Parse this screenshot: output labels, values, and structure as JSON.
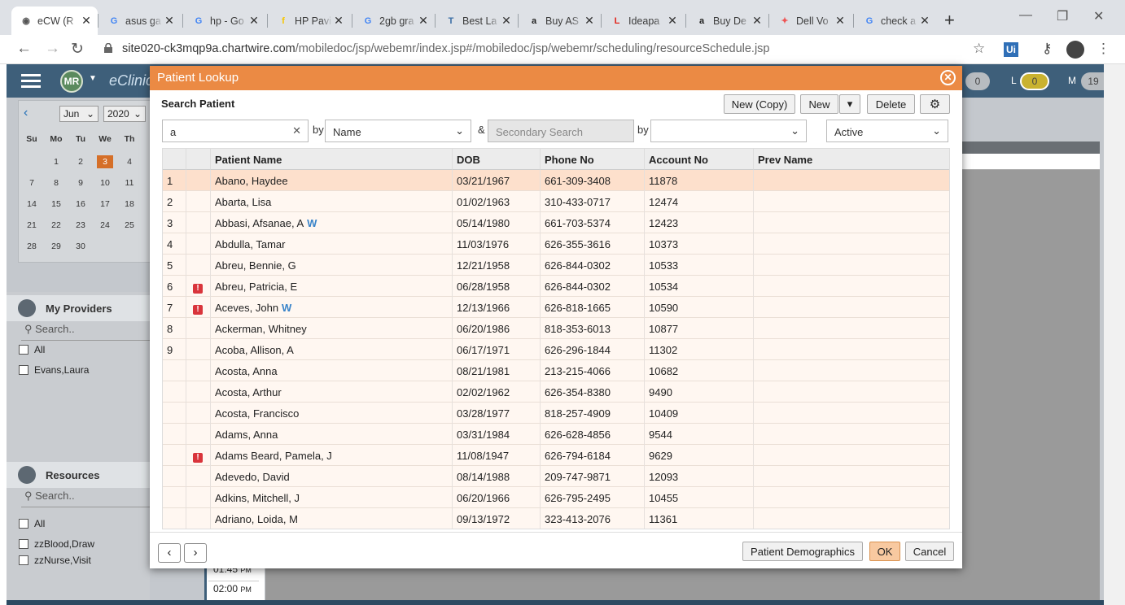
{
  "browser": {
    "tabs": [
      {
        "title": "eCW (R",
        "icon": "ecw-icon",
        "fav": "◉",
        "color": "#555"
      },
      {
        "title": "asus ga",
        "icon": "google-icon",
        "fav": "G",
        "color": "#4285f4"
      },
      {
        "title": "hp - Go",
        "icon": "google-icon",
        "fav": "G",
        "color": "#4285f4"
      },
      {
        "title": "HP Pavi",
        "icon": "flipkart-icon",
        "fav": "f",
        "color": "#f7c600"
      },
      {
        "title": "2gb gra",
        "icon": "google-icon",
        "fav": "G",
        "color": "#4285f4"
      },
      {
        "title": "Best La",
        "icon": "tab-icon",
        "fav": "T",
        "color": "#3b6ea5"
      },
      {
        "title": "Buy AS",
        "icon": "amazon-icon",
        "fav": "a",
        "color": "#222"
      },
      {
        "title": "Ideapa",
        "icon": "lenovo-icon",
        "fav": "L",
        "color": "#e2231a"
      },
      {
        "title": "Buy De",
        "icon": "amazon-icon",
        "fav": "a",
        "color": "#222"
      },
      {
        "title": "Dell Vo",
        "icon": "dell-icon",
        "fav": "✦",
        "color": "#e55"
      },
      {
        "title": "check a",
        "icon": "google-icon",
        "fav": "G",
        "color": "#4285f4"
      }
    ],
    "url_host": "site020-ck3mqp9a.chartwire.com",
    "url_path": "/mobiledoc/jsp/webemr/index.jsp#/mobiledoc/jsp/webemr/scheduling/resourceSchedule.jsp"
  },
  "app": {
    "user_initials": "MR",
    "brand": "eClinic",
    "pill_a": "0",
    "pill_l_label": "L",
    "pill_l": "0",
    "pill_m_label": "M",
    "pill_m": "19"
  },
  "calendar": {
    "month": "Jun",
    "year": "2020",
    "weekdays": [
      "Su",
      "Mo",
      "Tu",
      "We",
      "Th"
    ],
    "weeks": [
      [
        "",
        "1",
        "2",
        "3",
        "4"
      ],
      [
        "7",
        "8",
        "9",
        "10",
        "11"
      ],
      [
        "14",
        "15",
        "16",
        "17",
        "18"
      ],
      [
        "21",
        "22",
        "23",
        "24",
        "25"
      ],
      [
        "28",
        "29",
        "30",
        "",
        ""
      ]
    ],
    "today": "3"
  },
  "left": {
    "providers_title": "My Providers",
    "providers_search": "Search..",
    "providers": [
      "All",
      "Evans,Laura"
    ],
    "resources_title": "Resources",
    "resources_search": "Search..",
    "resources": [
      "All",
      "zzBlood,Draw",
      "zzNurse,Visit"
    ]
  },
  "schedule": {
    "times": [
      {
        "t": "01:45",
        "ampm": "PM"
      },
      {
        "t": "02:00",
        "ampm": "PM"
      }
    ]
  },
  "modal": {
    "title": "Patient Lookup",
    "section": "Search Patient",
    "buttons": {
      "new_copy": "New (Copy)",
      "new": "New",
      "delete": "Delete"
    },
    "search_value": "a",
    "by_label": "by",
    "by_value": "Name",
    "amp": "&",
    "secondary_placeholder": "Secondary Search",
    "by2_label": "by",
    "by2_value": "",
    "status_value": "Active",
    "columns": [
      "",
      "",
      "Patient Name",
      "DOB",
      "Phone No",
      "Account No",
      "Prev Name"
    ],
    "rows": [
      {
        "num": "1",
        "alert": false,
        "name": "Abano, Haydee",
        "w": false,
        "dob": "03/21/1967",
        "phone": "661-309-3408",
        "acct": "11878",
        "prev": ""
      },
      {
        "num": "2",
        "alert": false,
        "name": "Abarta, Lisa",
        "w": false,
        "dob": "01/02/1963",
        "phone": "310-433-0717",
        "acct": "12474",
        "prev": ""
      },
      {
        "num": "3",
        "alert": false,
        "name": "Abbasi, Afsanae, A",
        "w": true,
        "dob": "05/14/1980",
        "phone": "661-703-5374",
        "acct": "12423",
        "prev": ""
      },
      {
        "num": "4",
        "alert": false,
        "name": "Abdulla, Tamar",
        "w": false,
        "dob": "11/03/1976",
        "phone": "626-355-3616",
        "acct": "10373",
        "prev": ""
      },
      {
        "num": "5",
        "alert": false,
        "name": "Abreu, Bennie, G",
        "w": false,
        "dob": "12/21/1958",
        "phone": "626-844-0302",
        "acct": "10533",
        "prev": ""
      },
      {
        "num": "6",
        "alert": true,
        "name": "Abreu, Patricia, E",
        "w": false,
        "dob": "06/28/1958",
        "phone": "626-844-0302",
        "acct": "10534",
        "prev": ""
      },
      {
        "num": "7",
        "alert": true,
        "name": "Aceves, John",
        "w": true,
        "dob": "12/13/1966",
        "phone": "626-818-1665",
        "acct": "10590",
        "prev": ""
      },
      {
        "num": "8",
        "alert": false,
        "name": "Ackerman, Whitney",
        "w": false,
        "dob": "06/20/1986",
        "phone": "818-353-6013",
        "acct": "10877",
        "prev": ""
      },
      {
        "num": "9",
        "alert": false,
        "name": "Acoba, Allison, A",
        "w": false,
        "dob": "06/17/1971",
        "phone": "626-296-1844",
        "acct": "11302",
        "prev": ""
      },
      {
        "num": "",
        "alert": false,
        "name": "Acosta, Anna",
        "w": false,
        "dob": "08/21/1981",
        "phone": "213-215-4066",
        "acct": "10682",
        "prev": ""
      },
      {
        "num": "",
        "alert": false,
        "name": "Acosta, Arthur",
        "w": false,
        "dob": "02/02/1962",
        "phone": "626-354-8380",
        "acct": "9490",
        "prev": ""
      },
      {
        "num": "",
        "alert": false,
        "name": "Acosta, Francisco",
        "w": false,
        "dob": "03/28/1977",
        "phone": "818-257-4909",
        "acct": "10409",
        "prev": ""
      },
      {
        "num": "",
        "alert": false,
        "name": "Adams, Anna",
        "w": false,
        "dob": "03/31/1984",
        "phone": "626-628-4856",
        "acct": "9544",
        "prev": ""
      },
      {
        "num": "",
        "alert": true,
        "name": "Adams Beard, Pamela, J",
        "w": false,
        "dob": "11/08/1947",
        "phone": "626-794-6184",
        "acct": "9629",
        "prev": ""
      },
      {
        "num": "",
        "alert": false,
        "name": "Adevedo, David",
        "w": false,
        "dob": "08/14/1988",
        "phone": "209-747-9871",
        "acct": "12093",
        "prev": ""
      },
      {
        "num": "",
        "alert": false,
        "name": "Adkins, Mitchell, J",
        "w": false,
        "dob": "06/20/1966",
        "phone": "626-795-2495",
        "acct": "10455",
        "prev": ""
      },
      {
        "num": "",
        "alert": false,
        "name": "Adriano, Loida, M",
        "w": false,
        "dob": "09/13/1972",
        "phone": "323-413-2076",
        "acct": "11361",
        "prev": ""
      }
    ],
    "w_badge": "W",
    "alert_glyph": "!",
    "footer": {
      "prev": "‹",
      "next": "›",
      "demographics": "Patient Demographics",
      "ok": "OK",
      "cancel": "Cancel"
    },
    "colors": {
      "header": "#eb8a44",
      "selected_row": "#fde0cc",
      "row": "#fff7f1",
      "alert": "#d9343b",
      "w": "#3a84c9"
    }
  }
}
